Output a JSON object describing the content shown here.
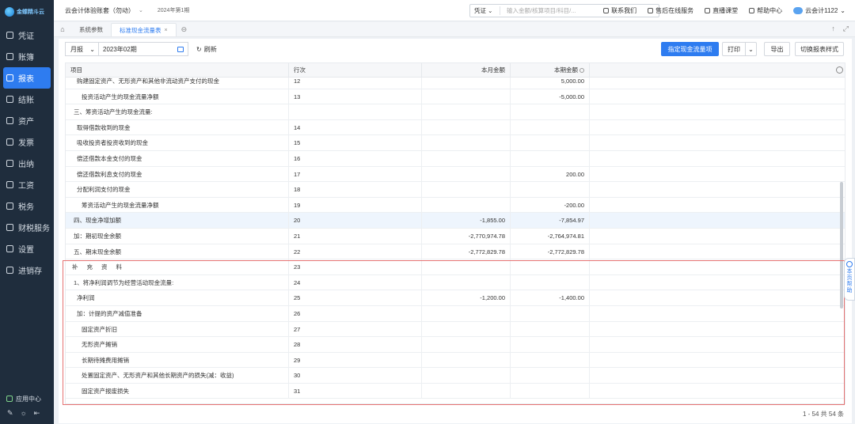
{
  "brand": {
    "logo_text": "金蝶精斗云"
  },
  "sidebar": {
    "items": [
      {
        "label": "凭证",
        "icon": "voucher-icon"
      },
      {
        "label": "账簿",
        "icon": "ledger-icon"
      },
      {
        "label": "报表",
        "icon": "report-icon",
        "active": true
      },
      {
        "label": "结账",
        "icon": "closing-icon"
      },
      {
        "label": "资产",
        "icon": "asset-icon"
      },
      {
        "label": "发票",
        "icon": "invoice-icon"
      },
      {
        "label": "出纳",
        "icon": "cashier-icon"
      },
      {
        "label": "工资",
        "icon": "salary-icon"
      },
      {
        "label": "税务",
        "icon": "tax-icon"
      },
      {
        "label": "财税服务",
        "icon": "service-icon"
      },
      {
        "label": "设置",
        "icon": "settings-icon"
      },
      {
        "label": "进销存",
        "icon": "inventory-icon"
      }
    ],
    "app_center": "应用中心"
  },
  "topbar": {
    "company": "云会计体验账套（勿动）",
    "period": "2024年第1期",
    "search_type": "凭证",
    "search_placeholder": "输入金额/核算项目/科目/...",
    "links": [
      "联系我们",
      "售后在线服务",
      "直播课堂",
      "帮助中心"
    ],
    "user": "云会计1122"
  },
  "tabs": {
    "items": [
      "系统参数",
      "标准现金流量表"
    ],
    "active_index": 1
  },
  "toolbar": {
    "period_type": "月报",
    "date": "2023年02期",
    "refresh": "刷新",
    "define_btn": "指定现金流量项",
    "print_btn": "打印",
    "export_btn": "导出",
    "switch_btn": "切换报表样式"
  },
  "table": {
    "headers": [
      "项目",
      "行次",
      "本月金额",
      "本期金额"
    ],
    "rows": [
      {
        "item": "购建固定资产、无形资产和其他非流动资产支付的现金",
        "line": "12",
        "month": "",
        "period": "5,000.00",
        "indent": 2
      },
      {
        "item": "投资活动产生的现金流量净额",
        "line": "13",
        "month": "",
        "period": "-5,000.00",
        "indent": 3
      },
      {
        "item": "三、筹资活动产生的现金流量:",
        "line": "",
        "month": "",
        "period": "",
        "indent": 1
      },
      {
        "item": "取得借款收到的现金",
        "line": "14",
        "month": "",
        "period": "",
        "indent": 2
      },
      {
        "item": "吸收投资者投资收到的现金",
        "line": "15",
        "month": "",
        "period": "",
        "indent": 2
      },
      {
        "item": "偿还借款本金支付的现金",
        "line": "16",
        "month": "",
        "period": "",
        "indent": 2
      },
      {
        "item": "偿还借款利息支付的现金",
        "line": "17",
        "month": "",
        "period": "200.00",
        "indent": 2
      },
      {
        "item": "分配利润支付的现金",
        "line": "18",
        "month": "",
        "period": "",
        "indent": 2
      },
      {
        "item": "筹资活动产生的现金流量净额",
        "line": "19",
        "month": "",
        "period": "-200.00",
        "indent": 3
      },
      {
        "item": "四、现金净增加额",
        "line": "20",
        "month": "-1,855.00",
        "period": "-7,854.97",
        "indent": 1,
        "highlight": true
      },
      {
        "item": "加：期初现金余额",
        "line": "21",
        "month": "-2,770,974.78",
        "period": "-2,764,974.81",
        "indent": 1
      },
      {
        "item": "五、期末现金余额",
        "line": "22",
        "month": "-2,772,829.78",
        "period": "-2,772,829.78",
        "indent": 1
      },
      {
        "item": "补充资料",
        "line": "23",
        "month": "",
        "period": "",
        "indent": 1,
        "spread": true
      },
      {
        "item": "1、将净利润调节为经营活动现金流量:",
        "line": "24",
        "month": "",
        "period": "",
        "indent": 1
      },
      {
        "item": "净利润",
        "line": "25",
        "month": "-1,200.00",
        "period": "-1,400.00",
        "indent": 2
      },
      {
        "item": "加：计提的资产减值准备",
        "line": "26",
        "month": "",
        "period": "",
        "indent": 2
      },
      {
        "item": "固定资产折旧",
        "line": "27",
        "month": "",
        "period": "",
        "indent": 3
      },
      {
        "item": "无形资产摊销",
        "line": "28",
        "month": "",
        "period": "",
        "indent": 3
      },
      {
        "item": "长期待摊费用摊销",
        "line": "29",
        "month": "",
        "period": "",
        "indent": 3
      },
      {
        "item": "处置固定资产、无形资产和其他长期资产的损失(减：收益)",
        "line": "30",
        "month": "",
        "period": "",
        "indent": 3
      },
      {
        "item": "固定资产报废损失",
        "line": "31",
        "month": "",
        "period": "",
        "indent": 3
      }
    ]
  },
  "pager": "1 - 54 共 54 条",
  "help_tab": "本页帮助"
}
